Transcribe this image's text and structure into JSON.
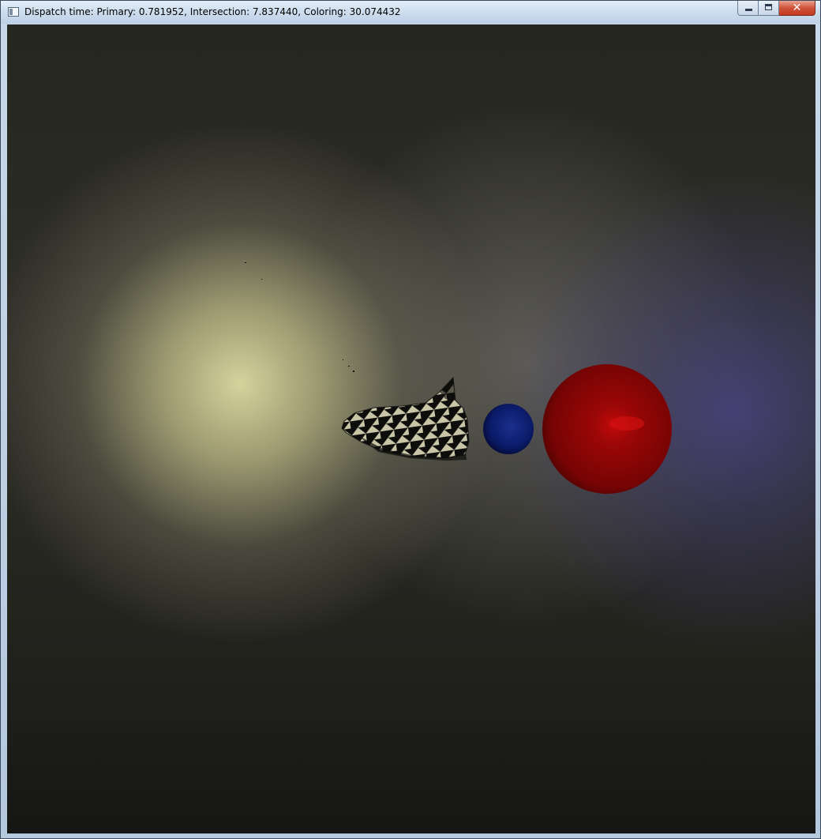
{
  "window": {
    "title": "Dispatch time: Primary: 0.781952, Intersection: 7.837440, Coloring: 30.074432",
    "buttons": {
      "minimize_icon": "minimize-icon",
      "maximize_icon": "maximize-icon",
      "close_glyph": "✕"
    }
  },
  "scene": {
    "objects": [
      "checkered-shuttle",
      "blue-sphere",
      "red-sphere"
    ],
    "colors": {
      "blue_sphere": "#0a1a66",
      "red_sphere": "#8a0505",
      "light_warm": "#d4d39c",
      "light_cool": "#46427a"
    }
  }
}
